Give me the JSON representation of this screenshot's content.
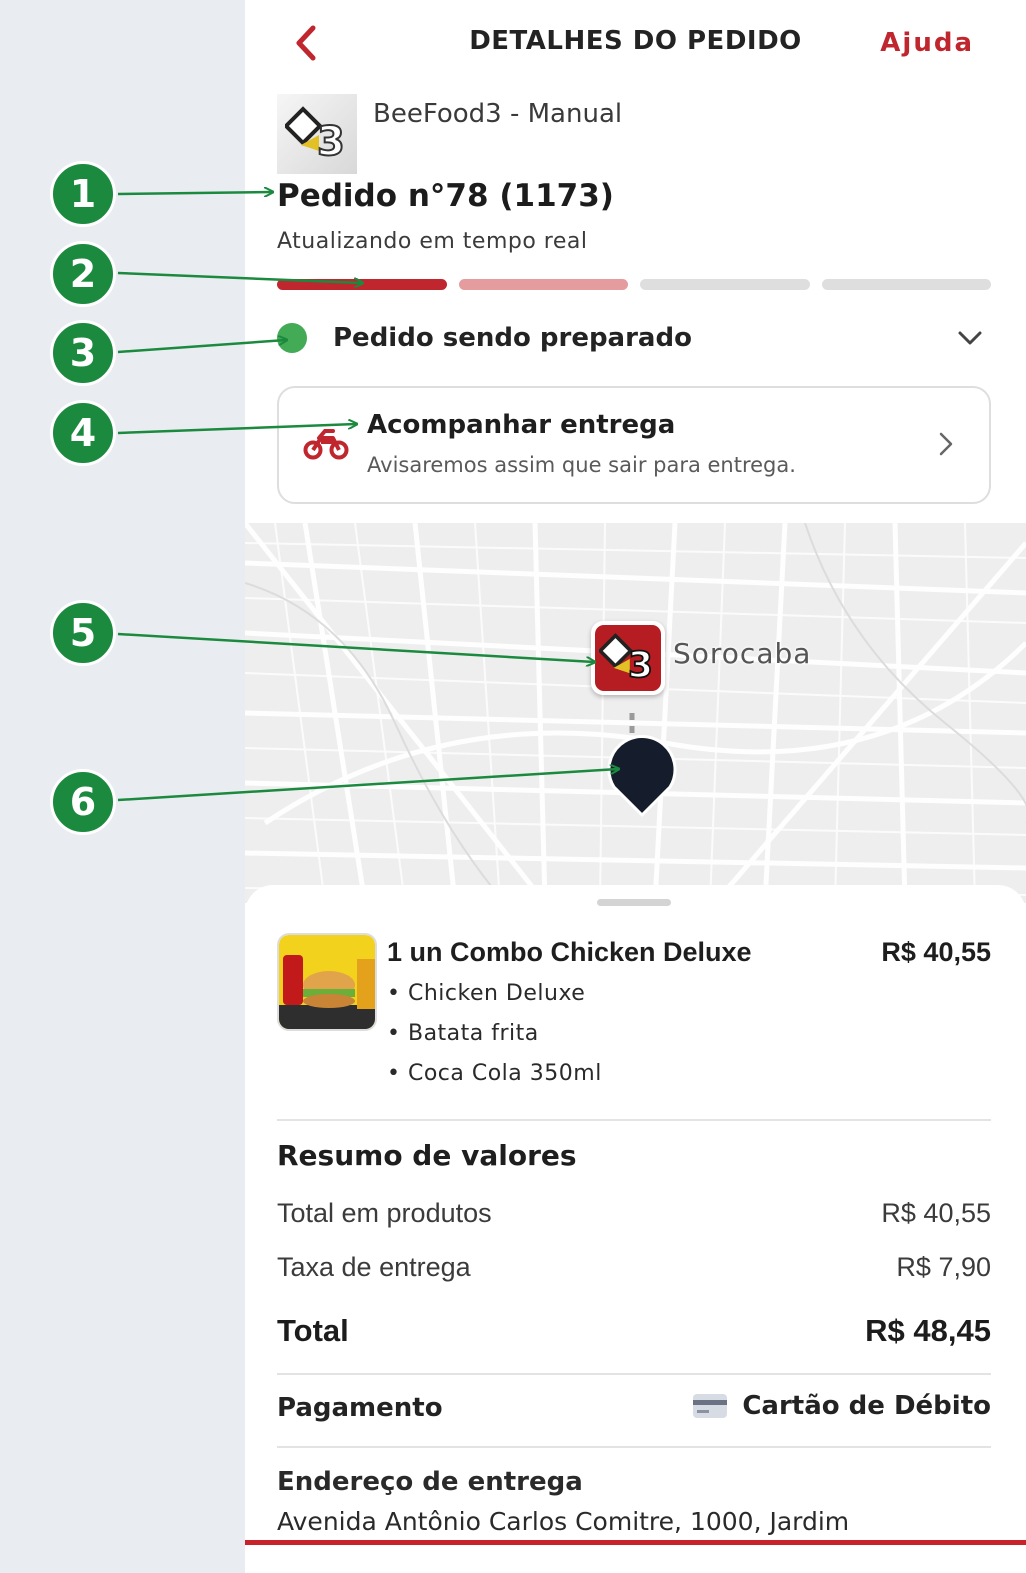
{
  "header": {
    "title": "DETALHES DO PEDIDO",
    "help_label": "Ajuda"
  },
  "store": {
    "name": "BeeFood3 - Manual"
  },
  "order": {
    "title": "Pedido n°78 (1173)",
    "subtitle": "Atualizando em tempo real",
    "progress_steps": [
      {
        "state": "done",
        "color": "#c0262d"
      },
      {
        "state": "current",
        "color": "#e49c9f"
      },
      {
        "state": "pending",
        "color": "#dedede"
      },
      {
        "state": "pending",
        "color": "#dedede"
      }
    ],
    "status": "Pedido sendo preparado",
    "status_color": "#43aa55"
  },
  "tracking": {
    "title": "Acompanhar entrega",
    "subtitle": "Avisaremos assim que sair para entrega."
  },
  "map": {
    "city": "Sorocaba"
  },
  "items": [
    {
      "name": "1 un Combo Chicken Deluxe",
      "price": "R$ 40,55",
      "addons": [
        "• Chicken Deluxe",
        "• Batata frita",
        "• Coca Cola 350ml"
      ]
    }
  ],
  "summary": {
    "title": "Resumo de valores",
    "products_label": "Total em produtos",
    "products_value": "R$ 40,55",
    "delivery_label": "Taxa de entrega",
    "delivery_value": "R$ 7,90",
    "total_label": "Total",
    "total_value": "R$ 48,45"
  },
  "payment": {
    "label": "Pagamento",
    "method": "Cartão de Débito"
  },
  "address": {
    "label": "Endereço de entrega",
    "text": "Avenida Antônio Carlos Comitre, 1000, Jardim"
  },
  "callouts": [
    "1",
    "2",
    "3",
    "4",
    "5",
    "6"
  ],
  "colors": {
    "brand": "#c0262d",
    "callout": "#1b8a3f"
  }
}
